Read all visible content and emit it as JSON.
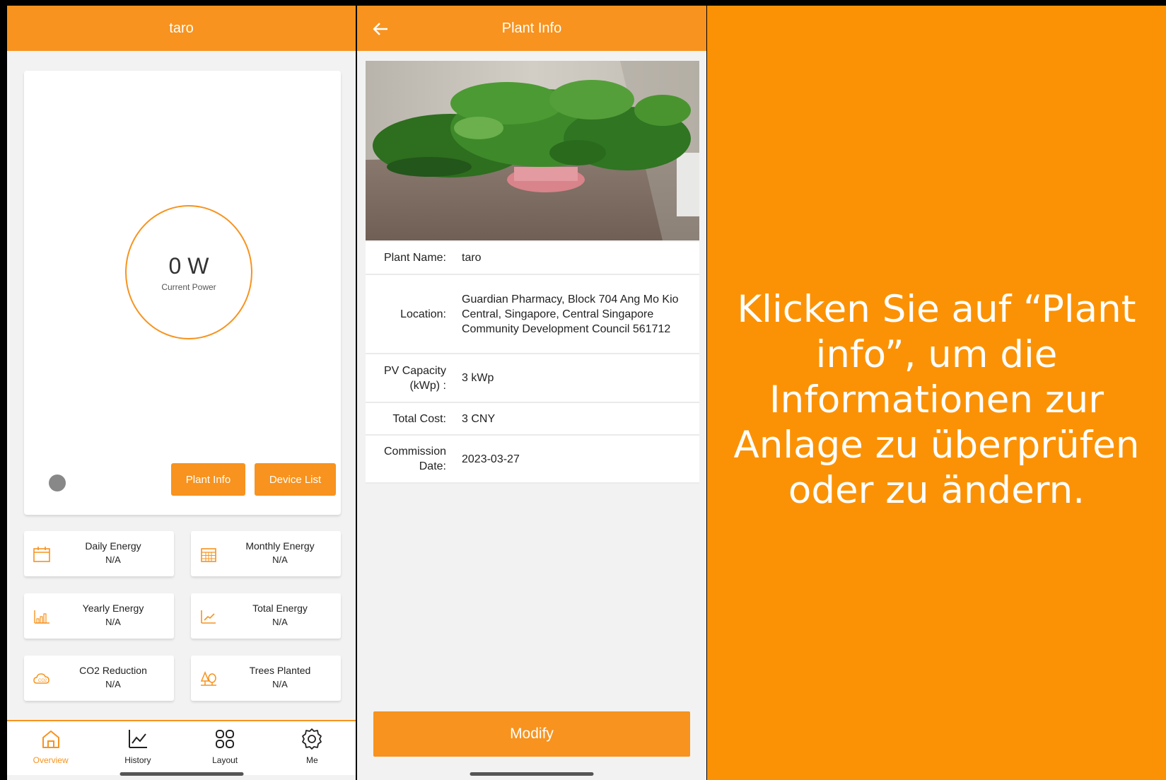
{
  "overview": {
    "title": "taro",
    "current_power_value": "0 W",
    "current_power_label": "Current Power",
    "plant_info_button": "Plant Info",
    "device_list_button": "Device List",
    "stats": [
      {
        "label": "Daily Energy",
        "value": "N/A",
        "icon": "calendar-icon"
      },
      {
        "label": "Monthly Energy",
        "value": "N/A",
        "icon": "calendar-grid-icon"
      },
      {
        "label": "Yearly Energy",
        "value": "N/A",
        "icon": "bar-chart-icon"
      },
      {
        "label": "Total Energy",
        "value": "N/A",
        "icon": "trend-chart-icon"
      },
      {
        "label": "CO2 Reduction",
        "value": "N/A",
        "icon": "co2-cloud-icon"
      },
      {
        "label": "Trees Planted",
        "value": "N/A",
        "icon": "trees-icon"
      }
    ],
    "nav": [
      {
        "label": "Overview",
        "icon": "home-icon",
        "active": true
      },
      {
        "label": "History",
        "icon": "line-chart-icon"
      },
      {
        "label": "Layout",
        "icon": "grid-icon"
      },
      {
        "label": "Me",
        "icon": "gear-icon"
      }
    ],
    "accent_color": "#f7931e"
  },
  "plant_info": {
    "title": "Plant Info",
    "rows": [
      {
        "label": "Plant Name:",
        "value": "taro"
      },
      {
        "label": "Location:",
        "value": "Guardian Pharmacy, Block 704 Ang Mo Kio Central, Singapore, Central Singapore Community Development Council 561712"
      },
      {
        "label": "PV Capacity (kWp) :",
        "value": "3 kWp"
      },
      {
        "label": "Total Cost:",
        "value": "3 CNY"
      },
      {
        "label": "Commission Date:",
        "value": "2023-03-27"
      }
    ],
    "modify_button": "Modify"
  },
  "instruction": {
    "text": "Klicken Sie auf “Plant info”, um die Informationen zur Anlage zu überprüfen oder zu ändern.",
    "background": "#fb9205"
  }
}
